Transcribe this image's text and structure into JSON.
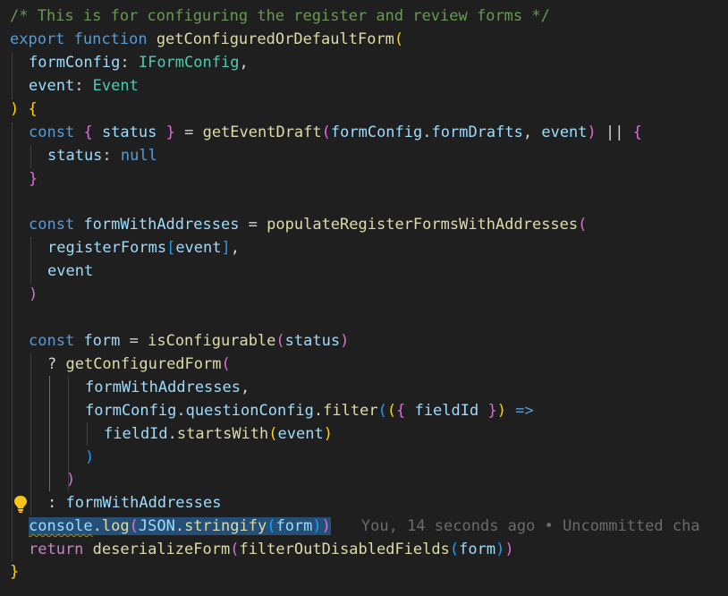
{
  "comment": "/* This is for configuring the register and review forms */",
  "code": {
    "export_kw": "export",
    "function_kw": "function",
    "fn_name": "getConfiguredOrDefaultForm",
    "param_formConfig": "formConfig",
    "type_IFormConfig": "IFormConfig",
    "param_event": "event",
    "type_Event": "Event",
    "const_kw": "const",
    "status": "status",
    "getEventDraft": "getEventDraft",
    "formConfig": "formConfig",
    "formDrafts": "formDrafts",
    "event": "event",
    "null_kw": "null",
    "formWithAddresses": "formWithAddresses",
    "populateFn": "populateRegisterFormsWithAddresses",
    "registerForms": "registerForms",
    "form": "form",
    "isConfigurable": "isConfigurable",
    "getConfiguredForm": "getConfiguredForm",
    "questionConfig": "questionConfig",
    "filter": "filter",
    "fieldId": "fieldId",
    "startsWith": "startsWith",
    "console": "console",
    "log": "log",
    "JSON": "JSON",
    "stringify": "stringify",
    "return_kw": "return",
    "deserializeForm": "deserializeForm",
    "filterOutDisabledFields": "filterOutDisabledFields"
  },
  "blame": "You, 14 seconds ago • Uncommitted cha",
  "colors": {
    "background": "#1f1f1f",
    "comment": "#6a9955",
    "keyword": "#569cd6",
    "function": "#dcdcaa",
    "type": "#4ec9b0",
    "variable": "#9cdcfe",
    "bracket_gold": "#ffd700",
    "bracket_purple": "#da70d6",
    "bracket_blue": "#179fff",
    "selection": "#264f78"
  },
  "icons": {
    "gutter": "lightbulb-icon"
  }
}
